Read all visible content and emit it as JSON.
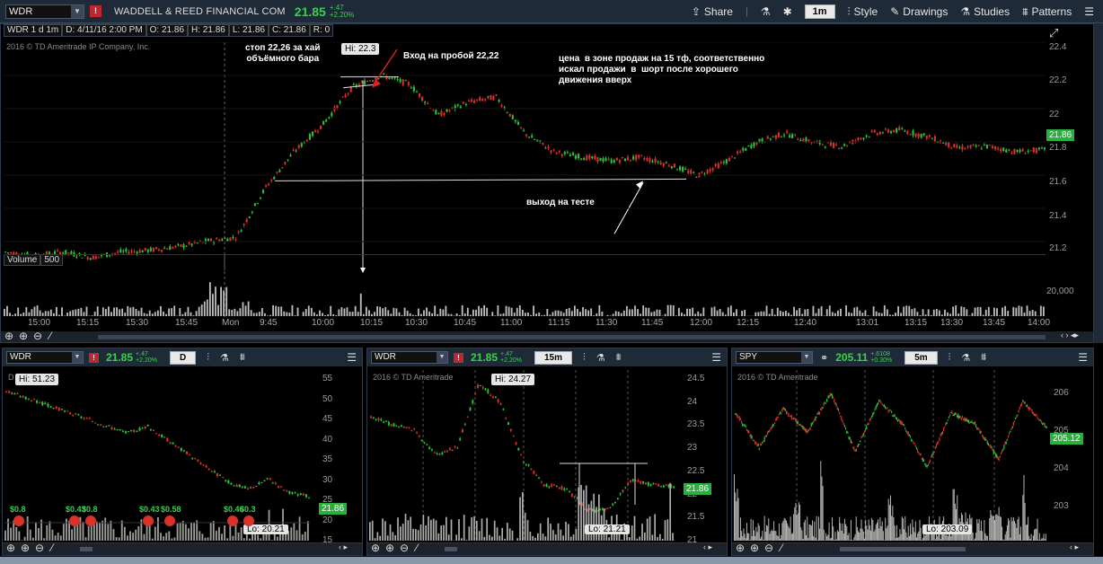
{
  "topbar": {
    "symbol": "WDR",
    "alert": "!",
    "company": "WADDELL & REED FINANCIAL COM",
    "price": "21.85",
    "change": "+.47",
    "change_pct": "+2.20%",
    "share": "Share",
    "aggregation": "1m",
    "style": "Style",
    "drawings": "Drawings",
    "studies": "Studies",
    "patterns": "Patterns"
  },
  "main": {
    "header": [
      "WDR 1 d 1m",
      "D: 4/11/16 2:00 PM",
      "O: 21.86",
      "H: 21.86",
      "L: 21.86",
      "C: 21.86",
      "R: 0"
    ],
    "copyright": "2016 © TD Ameritrade IP Company, Inc.",
    "hi_marker": "Hi: 22.3",
    "last_tag": "21.86",
    "annotations": {
      "stop": "стоп 22,26 за хай\nобъёмного бара",
      "entry": "Вход на пробой 22,22",
      "note": "цена  в зоне продаж на 15 тф, соответственно\nискал продажи  в  шорт после хорошего\nдвижения вверх",
      "exit": "выход на тесте"
    },
    "y_ticks": [
      "22.4",
      "22.2",
      "22",
      "21.8",
      "21.6",
      "21.4",
      "21.2"
    ],
    "volume_label": "Volume",
    "volume_value": "500",
    "volume_tick": "20,000",
    "time_ticks": [
      "15:00",
      "15:15",
      "15:30",
      "15:45",
      "Mon",
      "9:45",
      "10:00",
      "10:15",
      "10:30",
      "10:45",
      "11:00",
      "11:15",
      "11:30",
      "11:45",
      "12:00",
      "12:15",
      "12:40",
      "13:01",
      "13:15",
      "13:30",
      "13:45",
      "14:00"
    ]
  },
  "panels": [
    {
      "symbol": "WDR",
      "alert": "!",
      "price": "21.85",
      "change": "+.47",
      "change_pct": "+2.20%",
      "aggregation": "D",
      "copyright": "D Ameritrade",
      "hi_marker": "Hi: 51.23",
      "lo_marker": "Lo: 20.21",
      "last_tag": "21.86",
      "y_ticks": [
        "55",
        "50",
        "45",
        "40",
        "35",
        "30",
        "25",
        "20",
        "15"
      ],
      "events": [
        "$0.8",
        "$0.43",
        "$0.8",
        "$0.43",
        "$0.58",
        "$0.46",
        "$0.3"
      ]
    },
    {
      "symbol": "WDR",
      "alert": "!",
      "price": "21.85",
      "change": "+.47",
      "change_pct": "+2.20%",
      "aggregation": "15m",
      "copyright": "2016 © TD Ameritrade",
      "hi_marker": "Hi: 24.27",
      "lo_marker": "Lo: 21.21",
      "last_tag": "21.86",
      "y_ticks": [
        "24.5",
        "24",
        "23.5",
        "23",
        "22.5",
        "22",
        "21.5",
        "21"
      ]
    },
    {
      "symbol": "SPY",
      "alert": "",
      "price": "205.11",
      "change": "+.6108",
      "change_pct": "+0.30%",
      "aggregation": "5m",
      "copyright": "2016 © TD Ameritrade",
      "hi_marker": "",
      "lo_marker": "Lo: 203.09",
      "last_tag": "205.12",
      "y_ticks": [
        "206",
        "205",
        "204",
        "203"
      ]
    }
  ],
  "colors": {
    "up": "#2fbf3b",
    "down": "#d9302a",
    "bg": "#000000",
    "panel": "#1f2a38"
  }
}
